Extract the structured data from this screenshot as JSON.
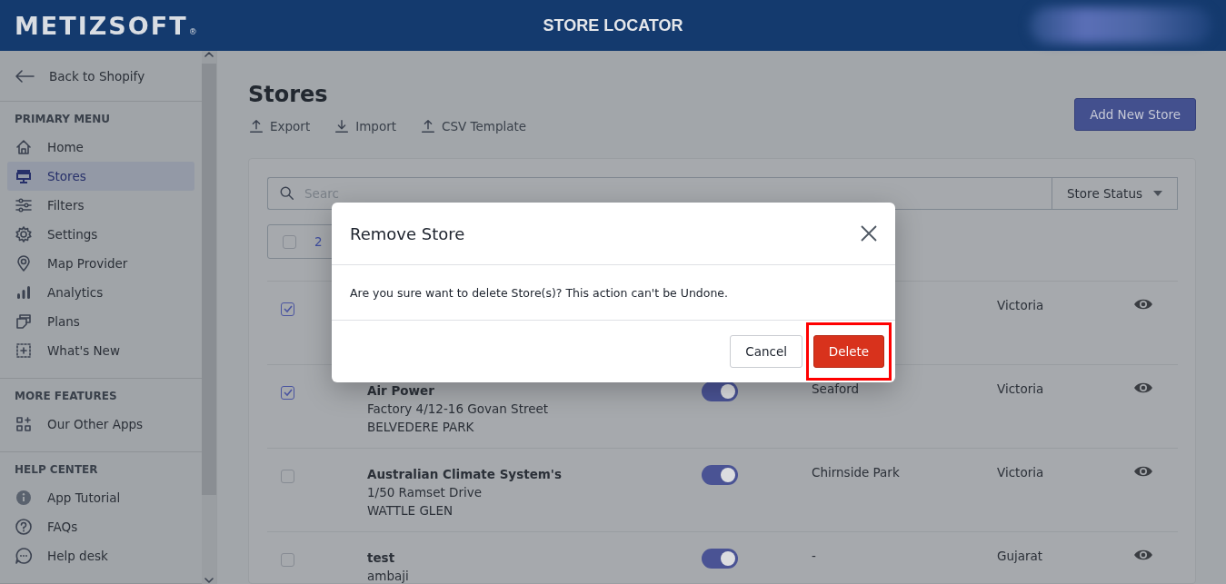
{
  "header": {
    "logo": "METIZSOFT",
    "logo_mark": "®",
    "title": "STORE LOCATOR"
  },
  "sidebar": {
    "back": "Back to Shopify",
    "sections": [
      {
        "heading": "PRIMARY MENU",
        "items": [
          {
            "label": "Home",
            "kind": "home",
            "selected": false
          },
          {
            "label": "Stores",
            "kind": "store",
            "selected": true
          },
          {
            "label": "Filters",
            "kind": "filters",
            "selected": false
          },
          {
            "label": "Settings",
            "kind": "settings",
            "selected": false
          },
          {
            "label": "Map Provider",
            "kind": "pin",
            "selected": false
          },
          {
            "label": "Analytics",
            "kind": "analytics",
            "selected": false
          },
          {
            "label": "Plans",
            "kind": "plans",
            "selected": false
          },
          {
            "label": "What's New",
            "kind": "new",
            "selected": false
          }
        ]
      },
      {
        "heading": "MORE FEATURES",
        "items": [
          {
            "label": "Our Other Apps",
            "kind": "apps",
            "selected": false
          }
        ]
      },
      {
        "heading": "HELP CENTER",
        "items": [
          {
            "label": "App Tutorial",
            "kind": "info",
            "selected": false
          },
          {
            "label": "FAQs",
            "kind": "question",
            "selected": false
          },
          {
            "label": "Help desk",
            "kind": "chat",
            "selected": false
          }
        ]
      }
    ]
  },
  "page": {
    "title": "Stores",
    "actions": [
      {
        "label": "Export",
        "kind": "upload"
      },
      {
        "label": "Import",
        "kind": "download"
      },
      {
        "label": "CSV Template",
        "kind": "upload"
      }
    ],
    "add_button": "Add New Store",
    "search": {
      "placeholder": "Searc"
    },
    "status_filter": "Store Status",
    "bulk": {
      "checked": false,
      "count": "2"
    },
    "rows": [
      {
        "checked": true,
        "state": "Victoria"
      },
      {
        "checked": true,
        "name": "Air Power",
        "address": [
          "Factory 4/12-16 Govan Street",
          "BELVEDERE PARK"
        ],
        "enabled": true,
        "city": "Seaford",
        "state": "Victoria"
      },
      {
        "checked": false,
        "name": "Australian Climate System's",
        "address": [
          "1/50 Ramset Drive",
          "WATTLE GLEN"
        ],
        "enabled": true,
        "city": "Chirnside Park",
        "state": "Victoria"
      },
      {
        "checked": false,
        "name": "test",
        "address": [
          "ambaji"
        ],
        "enabled": true,
        "city": "-",
        "state": "Gujarat"
      }
    ]
  },
  "dialog": {
    "title": "Remove Store",
    "message": "Are you sure want to delete Store(s)? This action can't be Undone.",
    "buttons": [
      {
        "label": "Cancel",
        "kind": "secondary",
        "highlighted": false
      },
      {
        "label": "Delete",
        "kind": "danger",
        "highlighted": true
      }
    ]
  }
}
